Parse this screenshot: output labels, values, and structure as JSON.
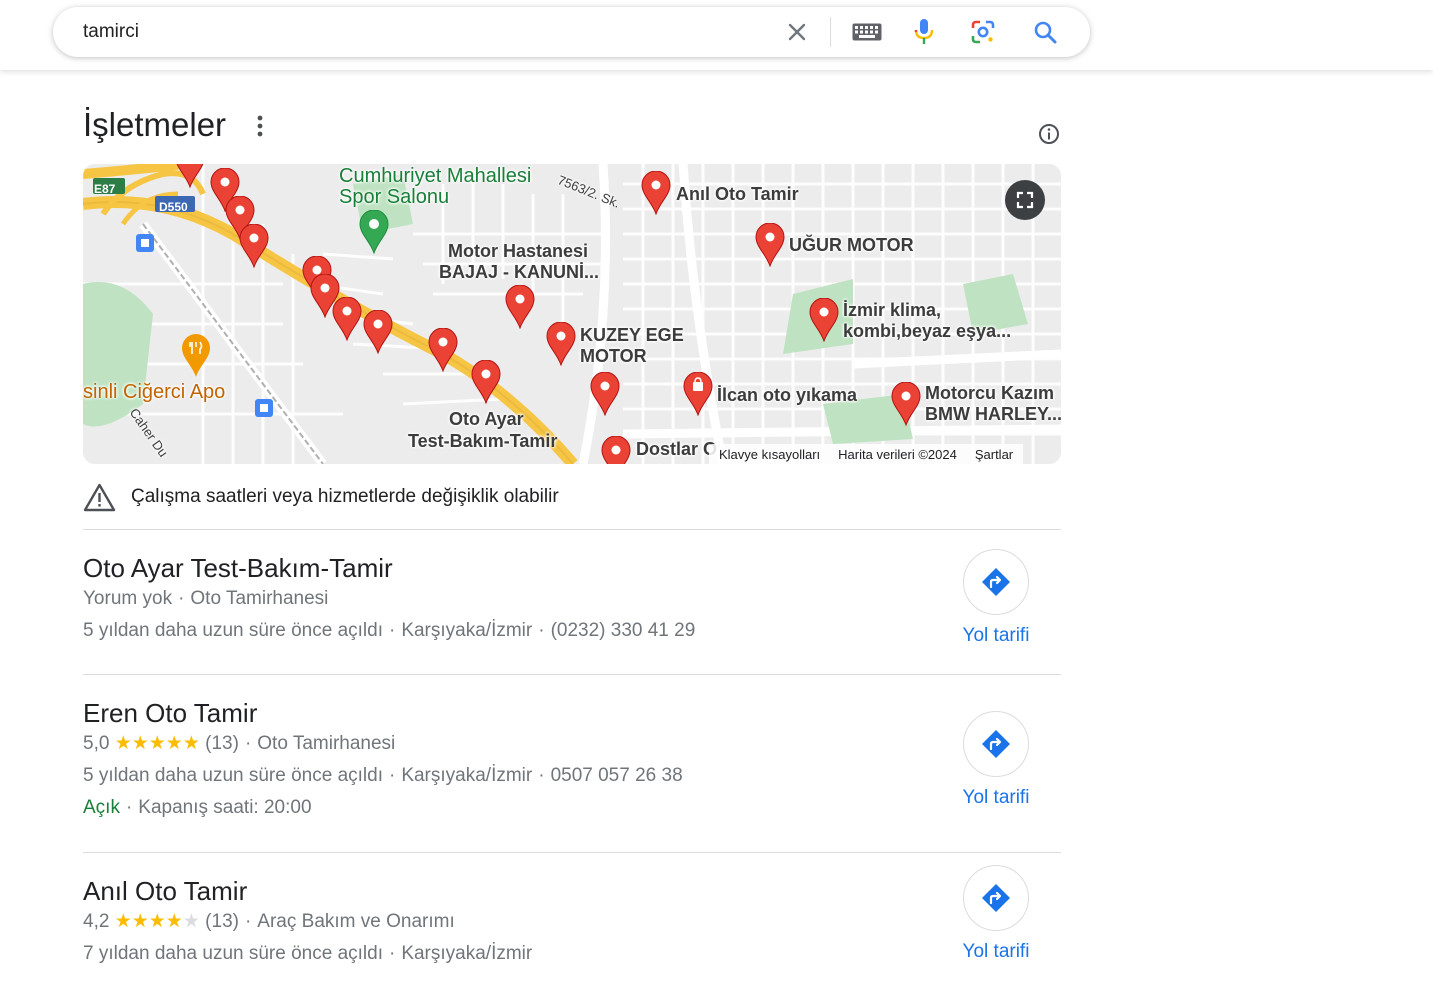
{
  "search": {
    "query": "tamirci"
  },
  "section": {
    "title": "İşletmeler"
  },
  "map": {
    "labels": {
      "spor_salonu": "Cumhuriyet Mahallesi Spor Salonu",
      "spor_salonu_1": "Cumhuriyet Mahallesi",
      "spor_salonu_2": "Spor Salonu",
      "motor_hastanesi_1": "Motor Hastanesi",
      "motor_hastanesi_2": "BAJAJ - KANUNİ...",
      "anil": "Anıl Oto Tamir",
      "ugur": "UĞUR MOTOR",
      "izmir_klima_1": "İzmir klima,",
      "izmir_klima_2": "kombi,beyaz eşya...",
      "kuzey_ege_1": "KUZEY EGE",
      "kuzey_ege_2": "MOTOR",
      "ilcan": "İlcan oto yıkama",
      "motorcu_1": "Motorcu Kazım",
      "motorcu_2": "BMW HARLEY...",
      "oto_ayar_1": "Oto Ayar",
      "oto_ayar_2": "Test-Bakım-Tamir",
      "dostlar": "Dostlar O",
      "cigerci": "sinli Ciğerci Apo",
      "street": "7563/2. Sk.",
      "caher": "Caher Du",
      "road_e87": "E87",
      "road_d550": "D550"
    },
    "footer": {
      "shortcuts": "Klavye kısayolları",
      "data": "Harita verileri ©2024",
      "terms": "Şartlar"
    }
  },
  "warning": {
    "text": "Çalışma saatleri veya hizmetlerde değişiklik olabilir"
  },
  "businesses": [
    {
      "name": "Oto Ayar Test-Bakım-Tamir",
      "review_text": "Yorum yok",
      "category": "Oto Tamirhanesi",
      "opened": "5 yıldan daha uzun süre önce açıldı",
      "location": "Karşıyaka/İzmir",
      "phone": "(0232) 330 41 29",
      "directions": "Yol tarifi"
    },
    {
      "name": "Eren Oto Tamir",
      "rating": "5,0",
      "stars": 5,
      "reviews": "(13)",
      "category": "Oto Tamirhanesi",
      "opened": "5 yıldan daha uzun süre önce açıldı",
      "location": "Karşıyaka/İzmir",
      "phone": "0507 057 26 38",
      "status": "Açık",
      "hours": "Kapanış saati: 20:00",
      "directions": "Yol tarifi"
    },
    {
      "name": "Anıl Oto Tamir",
      "rating": "4,2",
      "stars": 4,
      "reviews": "(13)",
      "category": "Araç Bakım ve Onarımı",
      "opened": "7 yıldan daha uzun süre önce açıldı",
      "location": "Karşıyaka/İzmir",
      "directions": "Yol tarifi"
    }
  ],
  "colors": {
    "link_blue": "#1a73e8",
    "open_green": "#188038",
    "star_yellow": "#fbbc04",
    "pin_red": "#ea4335"
  }
}
